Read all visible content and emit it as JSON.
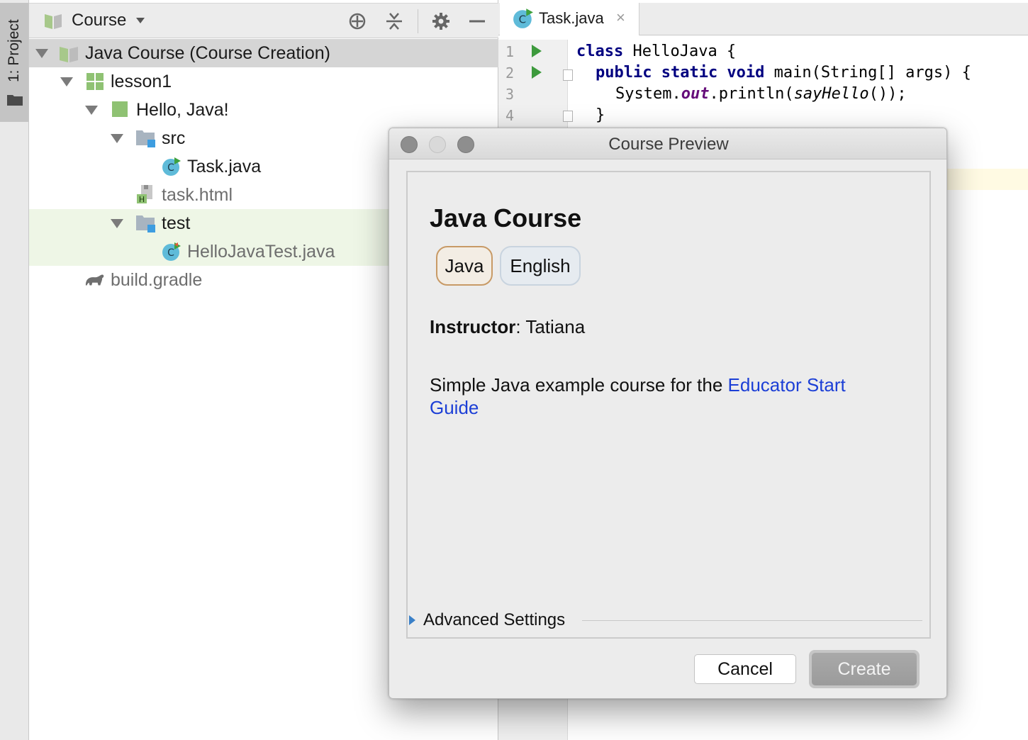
{
  "tool_stripe": {
    "tab_label": "1: Project"
  },
  "project_panel": {
    "view_selector": "Course",
    "tree": [
      {
        "label": "Java Course (Course Creation)",
        "icon": "course-icon",
        "expanded": true,
        "selected": true
      },
      {
        "label": "lesson1",
        "icon": "lesson-icon",
        "expanded": true
      },
      {
        "label": "Hello, Java!",
        "icon": "task-icon",
        "expanded": true
      },
      {
        "label": "src",
        "icon": "source-folder-icon",
        "expanded": true
      },
      {
        "label": "Task.java",
        "icon": "java-class-icon"
      },
      {
        "label": "task.html",
        "icon": "html-file-icon"
      },
      {
        "label": "test",
        "icon": "test-folder-icon",
        "expanded": true
      },
      {
        "label": "HelloJavaTest.java",
        "icon": "java-test-class-icon"
      },
      {
        "label": "build.gradle",
        "icon": "gradle-icon"
      }
    ]
  },
  "editor": {
    "tab_label": "Task.java",
    "close_glyph": "×",
    "line_numbers": [
      "1",
      "2",
      "3",
      "4"
    ],
    "code": {
      "l1_kw": "class",
      "l1_rest": " HelloJava {",
      "l2_kw": "public static void",
      "l2_rest": " main(String[] args) {",
      "l3_pre": "System.",
      "l3_field": "out",
      "l3_mid": ".println(",
      "l3_call": "sayHello",
      "l3_post": "());",
      "l4": "}"
    }
  },
  "dialog": {
    "title": "Course Preview",
    "course_name": "Java Course",
    "tags": {
      "language": "Java",
      "natural_language": "English"
    },
    "instructor_label": "Instructor",
    "instructor_sep": ": ",
    "instructor_name": "Tatiana",
    "description_text": "Simple Java example course for the ",
    "description_link": "Educator Start Guide",
    "advanced_settings": "Advanced Settings",
    "cancel_button": "Cancel",
    "create_button": "Create"
  }
}
